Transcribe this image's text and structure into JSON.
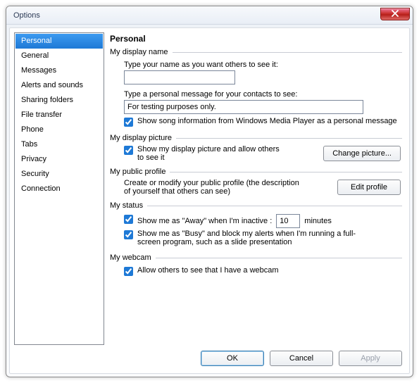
{
  "window": {
    "title": "Options"
  },
  "sidebar": {
    "items": [
      {
        "label": "Personal",
        "selected": true
      },
      {
        "label": "General"
      },
      {
        "label": "Messages"
      },
      {
        "label": "Alerts and sounds"
      },
      {
        "label": "Sharing folders"
      },
      {
        "label": "File transfer"
      },
      {
        "label": "Phone"
      },
      {
        "label": "Tabs"
      },
      {
        "label": "Privacy"
      },
      {
        "label": "Security"
      },
      {
        "label": "Connection"
      }
    ]
  },
  "page": {
    "title": "Personal",
    "display_name": {
      "legend": "My display name",
      "prompt": "Type your name as you want others to see it:",
      "value": "",
      "personal_msg_prompt": "Type a personal message for your contacts to see:",
      "personal_msg_value": "For testing purposes only.",
      "show_song_label": "Show song information from Windows Media Player as a personal message",
      "show_song_checked": true
    },
    "display_picture": {
      "legend": "My display picture",
      "show_label": "Show my display picture and allow others to see it",
      "show_checked": true,
      "change_btn": "Change picture..."
    },
    "public_profile": {
      "legend": "My public profile",
      "desc": "Create or modify your public profile (the description of yourself that others can see)",
      "edit_btn": "Edit profile"
    },
    "status": {
      "legend": "My status",
      "away_label_pre": "Show me as \"Away\" when I'm inactive :",
      "away_minutes": "10",
      "away_label_post": "minutes",
      "away_checked": true,
      "busy_label": "Show me as \"Busy\" and block my alerts when I'm running a full-screen program, such as a slide presentation",
      "busy_checked": true
    },
    "webcam": {
      "legend": "My webcam",
      "allow_label": "Allow others to see that I have a webcam",
      "allow_checked": true
    }
  },
  "footer": {
    "ok": "OK",
    "cancel": "Cancel",
    "apply": "Apply"
  }
}
